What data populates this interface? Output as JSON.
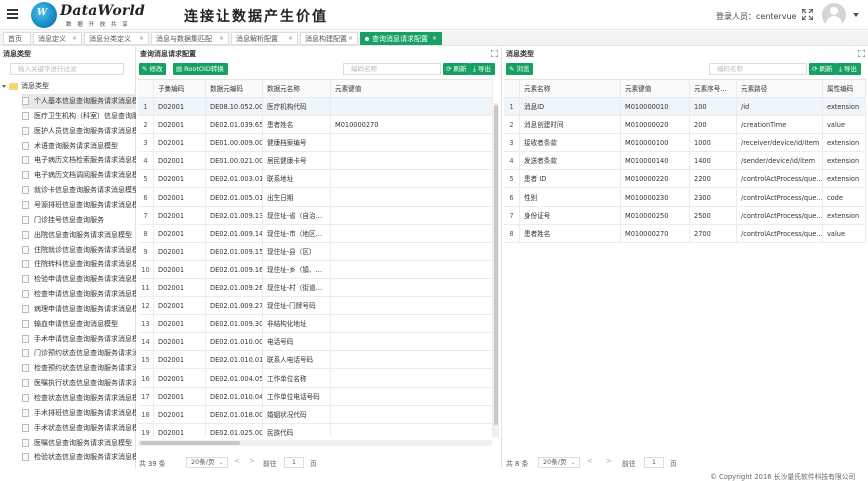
{
  "header": {
    "brand_name": "DataWorld",
    "brand_sub": "数 据 开 放 共 享",
    "slogan": "连接让数据产生价值",
    "user_label": "登录人员：centervue"
  },
  "tabs": [
    {
      "label": "首页",
      "closable": false
    },
    {
      "label": "消息定义",
      "closable": true
    },
    {
      "label": "消息分类定义",
      "closable": true
    },
    {
      "label": "消息与数据集匹配",
      "closable": true
    },
    {
      "label": "消息解析配置",
      "closable": true
    },
    {
      "label": "消息构建配置",
      "closable": true
    },
    {
      "label": "查询消息请求配置",
      "closable": true,
      "active": true
    }
  ],
  "left": {
    "title": "消息类型",
    "search_placeholder": "输入关键字进行过滤",
    "root": "消息类型",
    "items": [
      "个人基本信息查询服务请求消息模型",
      "医疗卫生机构（科室）信息查询服务",
      "医护人员信息查询服务请求消息模型",
      "术语查询服务请求消息模型",
      "电子病历文档检索服务请求消息模型",
      "电子病历文档调阅服务请求消息模型",
      "就诊卡信息查询服务请求消息模型",
      "号源排班信息查询服务请求消息模型",
      "门诊挂号信息查询服务",
      "出院信息查询服务请求消息模型",
      "住院就诊信息查询服务请求消息模型",
      "住院转科信息查询服务请求消息模型",
      "检验申请信息查询服务请求消息模型",
      "检查申请信息查询服务请求消息模型",
      "病理申请信息查询服务请求消息模型",
      "输血申请信息查询消息模型",
      "手术申请信息查询服务请求消息模型",
      "门诊预约状态信息查询服务请求消息模型",
      "检查预约状态信息查询服务请求消息模型",
      "医嘱执行状态信息查询服务请求消息模型",
      "检查状态信息查询服务请求消息模型",
      "手术排班信息查询服务请求消息模型",
      "手术状态信息查询服务请求消息模型",
      "医嘱信息查询服务请求消息模型",
      "检验状态信息查询服务请求消息模型"
    ]
  },
  "middle": {
    "title": "查询消息请求配置",
    "btn_edit": "修改",
    "btn_rootoid": "RootOID转换",
    "search_placeholder": "编码名称",
    "btn_refresh": "刷新",
    "btn_export": "导出",
    "columns": [
      "",
      "子集编码",
      "数据元编码",
      "数据元名称",
      "元素键值"
    ],
    "rows": [
      [
        "1",
        "D02001",
        "DE08.10.052.00",
        "医疗机构代码",
        ""
      ],
      [
        "2",
        "D02001",
        "DE02.01.039.65",
        "患者姓名",
        "M010000270"
      ],
      [
        "3",
        "D02001",
        "DE01.00.009.00",
        "健康档案编号",
        ""
      ],
      [
        "4",
        "D02001",
        "DE01.00.021.00",
        "居民健康卡号",
        ""
      ],
      [
        "5",
        "D02001",
        "DE02.01.003.01",
        "联系地址",
        ""
      ],
      [
        "6",
        "D02001",
        "DE02.01.005.01",
        "出生日期",
        ""
      ],
      [
        "7",
        "D02001",
        "DE02.01.009.13",
        "现住址-省（自治…",
        ""
      ],
      [
        "8",
        "D02001",
        "DE02.01.009.14",
        "现住址-市（地区…",
        ""
      ],
      [
        "9",
        "D02001",
        "DE02.01.009.15",
        "现住址-县（区）",
        ""
      ],
      [
        "10",
        "D02001",
        "DE02.01.009.16",
        "现住址-乡（镇、…",
        ""
      ],
      [
        "11",
        "D02001",
        "DE02.01.009.26",
        "现住址-村（街道…",
        ""
      ],
      [
        "12",
        "D02001",
        "DE02.01.009.27",
        "现住址-门牌号码",
        ""
      ],
      [
        "13",
        "D02001",
        "DE02.01.009.30",
        "非结构化地址",
        ""
      ],
      [
        "14",
        "D02001",
        "DE02.01.010.00",
        "电话号码",
        ""
      ],
      [
        "15",
        "D02001",
        "DE02.01.010.01",
        "联系人电话号码",
        ""
      ],
      [
        "16",
        "D02001",
        "DE02.01.004.05",
        "工作单位名称",
        ""
      ],
      [
        "17",
        "D02001",
        "DE02.01.010.04",
        "工作单位电话号码",
        ""
      ],
      [
        "18",
        "D02001",
        "DE02.01.018.00",
        "婚姻状况代码",
        ""
      ],
      [
        "19",
        "D02001",
        "DE02.01.025.00",
        "民族代码",
        ""
      ]
    ],
    "pager": {
      "total": "共 39 条",
      "page_size": "20条/页",
      "goto": "前往",
      "page": "1",
      "unit": "页"
    }
  },
  "right": {
    "title": "消息类型",
    "btn_browse": "浏览",
    "search_placeholder": "编码名称",
    "btn_refresh": "刷新",
    "btn_export": "导出",
    "columns": [
      "",
      "元素名称",
      "元素键值",
      "元素序号…",
      "元素路径",
      "属性编码"
    ],
    "rows": [
      [
        "1",
        "消息ID",
        "M010000010",
        "100",
        "/id",
        "extension"
      ],
      [
        "2",
        "消息创建时间",
        "M010000020",
        "200",
        "/creationTime",
        "value"
      ],
      [
        "3",
        "接收者条款",
        "M010000100",
        "1000",
        "/receiver/device/id/item",
        "extension"
      ],
      [
        "4",
        "发送者条款",
        "M010000140",
        "1400",
        "/sender/device/id/item",
        "extension"
      ],
      [
        "5",
        "患者 ID",
        "M010000220",
        "2200",
        "/controlActProcess/que…",
        "extension"
      ],
      [
        "6",
        "性别",
        "M010000230",
        "2300",
        "/controlActProcess/que…",
        "code"
      ],
      [
        "7",
        "身份证号",
        "M010000250",
        "2500",
        "/controlActProcess/que…",
        "extension"
      ],
      [
        "8",
        "患者姓名",
        "M010000270",
        "2700",
        "/controlActProcess/que…",
        "value"
      ]
    ],
    "pager": {
      "total": "共 8 条",
      "page_size": "20条/页",
      "goto": "前往",
      "page": "1",
      "unit": "页"
    }
  },
  "footer": {
    "copyright": "© Copyright 2016 长沙量氏软件科技有限公司"
  },
  "colors": {
    "accent": "#16a064"
  }
}
